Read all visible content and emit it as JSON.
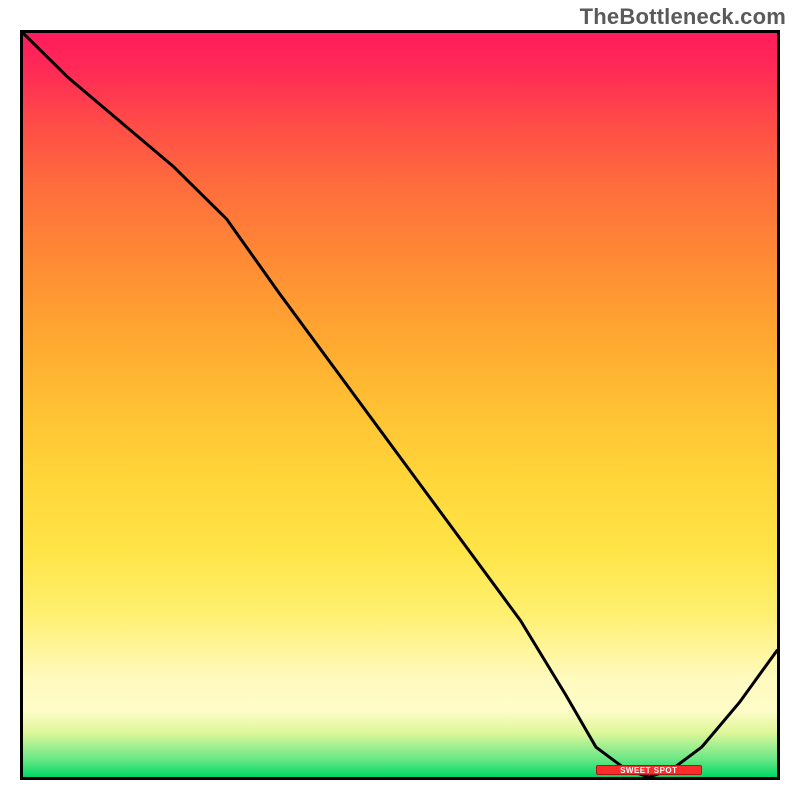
{
  "watermark": "TheBottleneck.com",
  "sweet_spot": {
    "label": "SWEET SPOT",
    "x_start": 0.76,
    "x_end": 0.9
  },
  "chart_data": {
    "type": "line",
    "title": "",
    "xlabel": "",
    "ylabel": "",
    "xlim": [
      0,
      1
    ],
    "ylim": [
      0,
      1
    ],
    "series": [
      {
        "name": "bottleneck-curve",
        "points": [
          {
            "x": 0.0,
            "y": 1.0
          },
          {
            "x": 0.06,
            "y": 0.94
          },
          {
            "x": 0.13,
            "y": 0.88
          },
          {
            "x": 0.2,
            "y": 0.82
          },
          {
            "x": 0.26,
            "y": 0.76
          },
          {
            "x": 0.27,
            "y": 0.75
          },
          {
            "x": 0.34,
            "y": 0.65
          },
          {
            "x": 0.42,
            "y": 0.54
          },
          {
            "x": 0.5,
            "y": 0.43
          },
          {
            "x": 0.58,
            "y": 0.32
          },
          {
            "x": 0.66,
            "y": 0.21
          },
          {
            "x": 0.72,
            "y": 0.11
          },
          {
            "x": 0.76,
            "y": 0.04
          },
          {
            "x": 0.8,
            "y": 0.01
          },
          {
            "x": 0.83,
            "y": 0.0
          },
          {
            "x": 0.86,
            "y": 0.01
          },
          {
            "x": 0.9,
            "y": 0.04
          },
          {
            "x": 0.95,
            "y": 0.1
          },
          {
            "x": 1.0,
            "y": 0.17
          }
        ]
      }
    ],
    "gradient_stops": [
      {
        "pos": 0.0,
        "color": "#ff1c5c"
      },
      {
        "pos": 0.5,
        "color": "#ffc033"
      },
      {
        "pos": 0.8,
        "color": "#fff070"
      },
      {
        "pos": 0.92,
        "color": "#fffcc8"
      },
      {
        "pos": 1.0,
        "color": "#00d866"
      }
    ],
    "annotations": [
      {
        "name": "sweet-spot",
        "x_start": 0.76,
        "x_end": 0.9,
        "y": 0.0
      }
    ]
  }
}
